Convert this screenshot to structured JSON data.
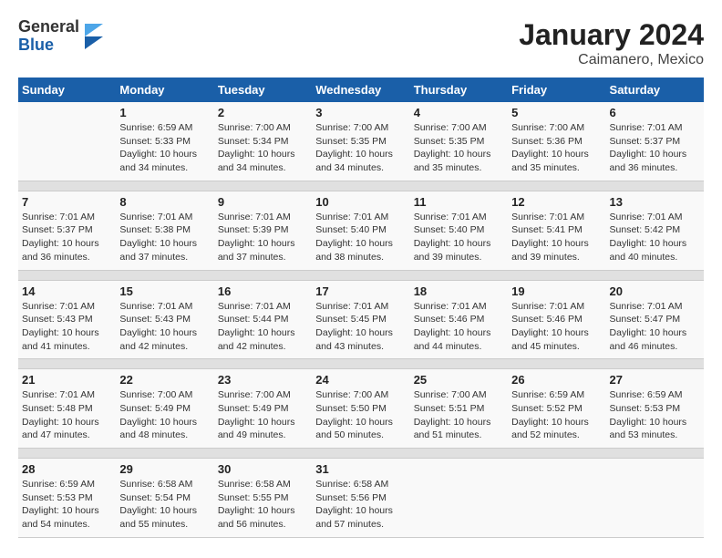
{
  "header": {
    "logo": {
      "general": "General",
      "blue": "Blue"
    },
    "title": "January 2024",
    "subtitle": "Caimanero, Mexico"
  },
  "calendar": {
    "days_of_week": [
      "Sunday",
      "Monday",
      "Tuesday",
      "Wednesday",
      "Thursday",
      "Friday",
      "Saturday"
    ],
    "weeks": [
      [
        {
          "day": "",
          "info": ""
        },
        {
          "day": "1",
          "info": "Sunrise: 6:59 AM\nSunset: 5:33 PM\nDaylight: 10 hours\nand 34 minutes."
        },
        {
          "day": "2",
          "info": "Sunrise: 7:00 AM\nSunset: 5:34 PM\nDaylight: 10 hours\nand 34 minutes."
        },
        {
          "day": "3",
          "info": "Sunrise: 7:00 AM\nSunset: 5:35 PM\nDaylight: 10 hours\nand 34 minutes."
        },
        {
          "day": "4",
          "info": "Sunrise: 7:00 AM\nSunset: 5:35 PM\nDaylight: 10 hours\nand 35 minutes."
        },
        {
          "day": "5",
          "info": "Sunrise: 7:00 AM\nSunset: 5:36 PM\nDaylight: 10 hours\nand 35 minutes."
        },
        {
          "day": "6",
          "info": "Sunrise: 7:01 AM\nSunset: 5:37 PM\nDaylight: 10 hours\nand 36 minutes."
        }
      ],
      [
        {
          "day": "7",
          "info": "Sunrise: 7:01 AM\nSunset: 5:37 PM\nDaylight: 10 hours\nand 36 minutes."
        },
        {
          "day": "8",
          "info": "Sunrise: 7:01 AM\nSunset: 5:38 PM\nDaylight: 10 hours\nand 37 minutes."
        },
        {
          "day": "9",
          "info": "Sunrise: 7:01 AM\nSunset: 5:39 PM\nDaylight: 10 hours\nand 37 minutes."
        },
        {
          "day": "10",
          "info": "Sunrise: 7:01 AM\nSunset: 5:40 PM\nDaylight: 10 hours\nand 38 minutes."
        },
        {
          "day": "11",
          "info": "Sunrise: 7:01 AM\nSunset: 5:40 PM\nDaylight: 10 hours\nand 39 minutes."
        },
        {
          "day": "12",
          "info": "Sunrise: 7:01 AM\nSunset: 5:41 PM\nDaylight: 10 hours\nand 39 minutes."
        },
        {
          "day": "13",
          "info": "Sunrise: 7:01 AM\nSunset: 5:42 PM\nDaylight: 10 hours\nand 40 minutes."
        }
      ],
      [
        {
          "day": "14",
          "info": "Sunrise: 7:01 AM\nSunset: 5:43 PM\nDaylight: 10 hours\nand 41 minutes."
        },
        {
          "day": "15",
          "info": "Sunrise: 7:01 AM\nSunset: 5:43 PM\nDaylight: 10 hours\nand 42 minutes."
        },
        {
          "day": "16",
          "info": "Sunrise: 7:01 AM\nSunset: 5:44 PM\nDaylight: 10 hours\nand 42 minutes."
        },
        {
          "day": "17",
          "info": "Sunrise: 7:01 AM\nSunset: 5:45 PM\nDaylight: 10 hours\nand 43 minutes."
        },
        {
          "day": "18",
          "info": "Sunrise: 7:01 AM\nSunset: 5:46 PM\nDaylight: 10 hours\nand 44 minutes."
        },
        {
          "day": "19",
          "info": "Sunrise: 7:01 AM\nSunset: 5:46 PM\nDaylight: 10 hours\nand 45 minutes."
        },
        {
          "day": "20",
          "info": "Sunrise: 7:01 AM\nSunset: 5:47 PM\nDaylight: 10 hours\nand 46 minutes."
        }
      ],
      [
        {
          "day": "21",
          "info": "Sunrise: 7:01 AM\nSunset: 5:48 PM\nDaylight: 10 hours\nand 47 minutes."
        },
        {
          "day": "22",
          "info": "Sunrise: 7:00 AM\nSunset: 5:49 PM\nDaylight: 10 hours\nand 48 minutes."
        },
        {
          "day": "23",
          "info": "Sunrise: 7:00 AM\nSunset: 5:49 PM\nDaylight: 10 hours\nand 49 minutes."
        },
        {
          "day": "24",
          "info": "Sunrise: 7:00 AM\nSunset: 5:50 PM\nDaylight: 10 hours\nand 50 minutes."
        },
        {
          "day": "25",
          "info": "Sunrise: 7:00 AM\nSunset: 5:51 PM\nDaylight: 10 hours\nand 51 minutes."
        },
        {
          "day": "26",
          "info": "Sunrise: 6:59 AM\nSunset: 5:52 PM\nDaylight: 10 hours\nand 52 minutes."
        },
        {
          "day": "27",
          "info": "Sunrise: 6:59 AM\nSunset: 5:53 PM\nDaylight: 10 hours\nand 53 minutes."
        }
      ],
      [
        {
          "day": "28",
          "info": "Sunrise: 6:59 AM\nSunset: 5:53 PM\nDaylight: 10 hours\nand 54 minutes."
        },
        {
          "day": "29",
          "info": "Sunrise: 6:58 AM\nSunset: 5:54 PM\nDaylight: 10 hours\nand 55 minutes."
        },
        {
          "day": "30",
          "info": "Sunrise: 6:58 AM\nSunset: 5:55 PM\nDaylight: 10 hours\nand 56 minutes."
        },
        {
          "day": "31",
          "info": "Sunrise: 6:58 AM\nSunset: 5:56 PM\nDaylight: 10 hours\nand 57 minutes."
        },
        {
          "day": "",
          "info": ""
        },
        {
          "day": "",
          "info": ""
        },
        {
          "day": "",
          "info": ""
        }
      ]
    ]
  }
}
